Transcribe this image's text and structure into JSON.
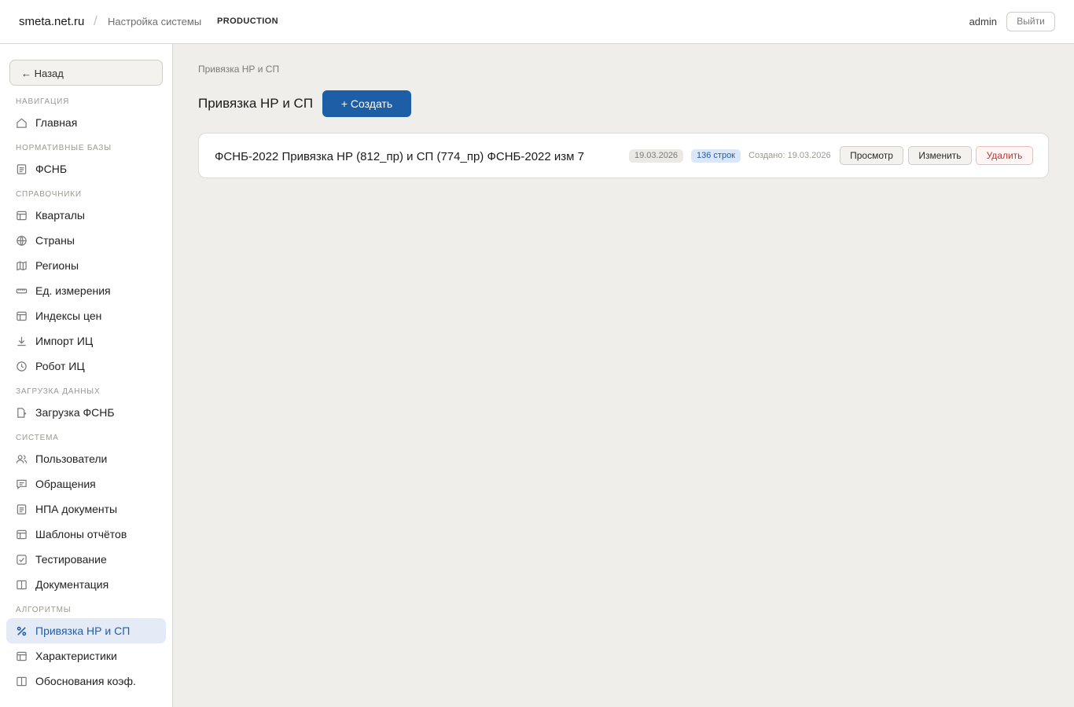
{
  "header": {
    "brand": "smeta.net.ru",
    "separator": "/",
    "section": "Настройка системы",
    "environment": "PRODUCTION",
    "user": "admin",
    "logout_label": "Выйти"
  },
  "sidebar": {
    "back_label": "← Назад",
    "sections": [
      {
        "title": "Навигация",
        "items": [
          {
            "label": "Главная",
            "icon": "home-icon"
          }
        ]
      },
      {
        "title": "Нормативные базы",
        "items": [
          {
            "label": "ФСНБ",
            "icon": "document-icon"
          }
        ]
      },
      {
        "title": "Справочники",
        "items": [
          {
            "label": "Кварталы",
            "icon": "table-icon"
          },
          {
            "label": "Страны",
            "icon": "globe-icon"
          },
          {
            "label": "Регионы",
            "icon": "map-icon"
          },
          {
            "label": "Ед. измерения",
            "icon": "ruler-icon"
          },
          {
            "label": "Индексы цен",
            "icon": "table-icon"
          },
          {
            "label": "Импорт ИЦ",
            "icon": "download-icon"
          },
          {
            "label": "Робот ИЦ",
            "icon": "clock-icon"
          }
        ]
      },
      {
        "title": "Загрузка данных",
        "items": [
          {
            "label": "Загрузка ФСНБ",
            "icon": "upload-file-icon"
          }
        ]
      },
      {
        "title": "Система",
        "items": [
          {
            "label": "Пользователи",
            "icon": "users-icon"
          },
          {
            "label": "Обращения",
            "icon": "message-icon"
          },
          {
            "label": "НПА документы",
            "icon": "document-icon"
          },
          {
            "label": "Шаблоны отчётов",
            "icon": "table-icon"
          },
          {
            "label": "Тестирование",
            "icon": "checkbox-icon"
          },
          {
            "label": "Документация",
            "icon": "book-icon"
          }
        ]
      },
      {
        "title": "Алгоритмы",
        "items": [
          {
            "label": "Привязка НР и СП",
            "icon": "percent-icon",
            "active": true
          },
          {
            "label": "Характеристики",
            "icon": "table-icon"
          },
          {
            "label": "Обоснования коэф.",
            "icon": "book-icon"
          }
        ]
      }
    ]
  },
  "main": {
    "breadcrumb": "Привязка НР и СП",
    "title": "Привязка НР и СП",
    "create_label": "+ Создать",
    "records": [
      {
        "title": "ФСНБ-2022 Привязка НР (812_пр) и СП (774_пр) ФСНБ-2022 изм 7",
        "date": "19.03.2026",
        "rows": "136 строк",
        "created": "Создано: 19.03.2026",
        "view_label": "Просмотр",
        "edit_label": "Изменить",
        "delete_label": "Удалить"
      }
    ]
  },
  "colors": {
    "accent": "#1e5ea7",
    "danger": "#c8362b",
    "background": "#efeeea"
  }
}
